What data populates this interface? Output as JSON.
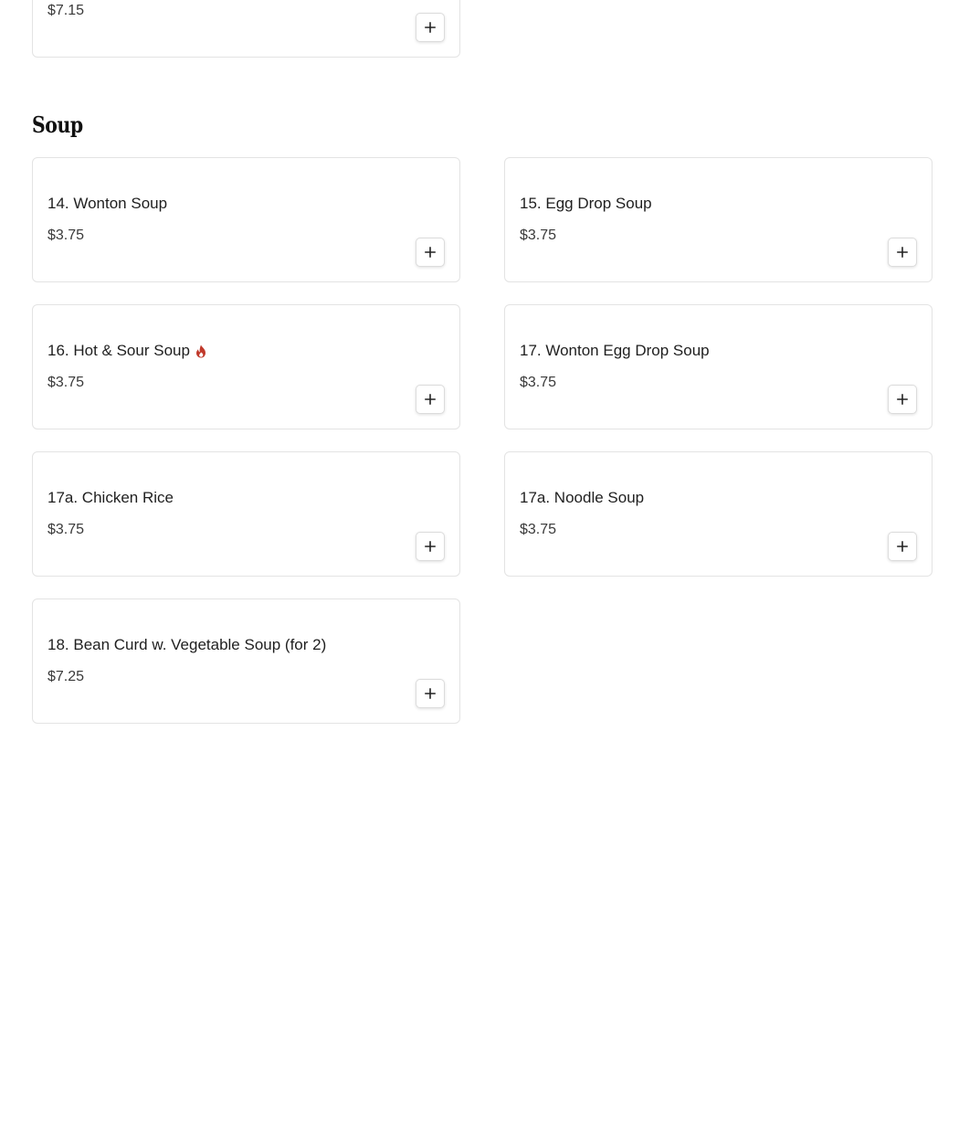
{
  "previous_section": {
    "last_item": {
      "price": "$7.15"
    }
  },
  "section": {
    "title": "Soup",
    "items": [
      {
        "name": "14. Wonton Soup",
        "price": "$3.75",
        "spicy": false
      },
      {
        "name": "15. Egg Drop Soup",
        "price": "$3.75",
        "spicy": false
      },
      {
        "name": "16. Hot & Sour Soup",
        "price": "$3.75",
        "spicy": true
      },
      {
        "name": "17. Wonton Egg Drop Soup",
        "price": "$3.75",
        "spicy": false
      },
      {
        "name": "17a. Chicken Rice",
        "price": "$3.75",
        "spicy": false
      },
      {
        "name": "17a. Noodle Soup",
        "price": "$3.75",
        "spicy": false
      },
      {
        "name": "18. Bean Curd w. Vegetable Soup (for 2)",
        "price": "$7.25",
        "spicy": false
      }
    ]
  },
  "icons": {
    "add": "plus-icon",
    "spicy": "flame-icon"
  },
  "colors": {
    "spicy": "#c0392b",
    "border": "#e3e3e3"
  }
}
